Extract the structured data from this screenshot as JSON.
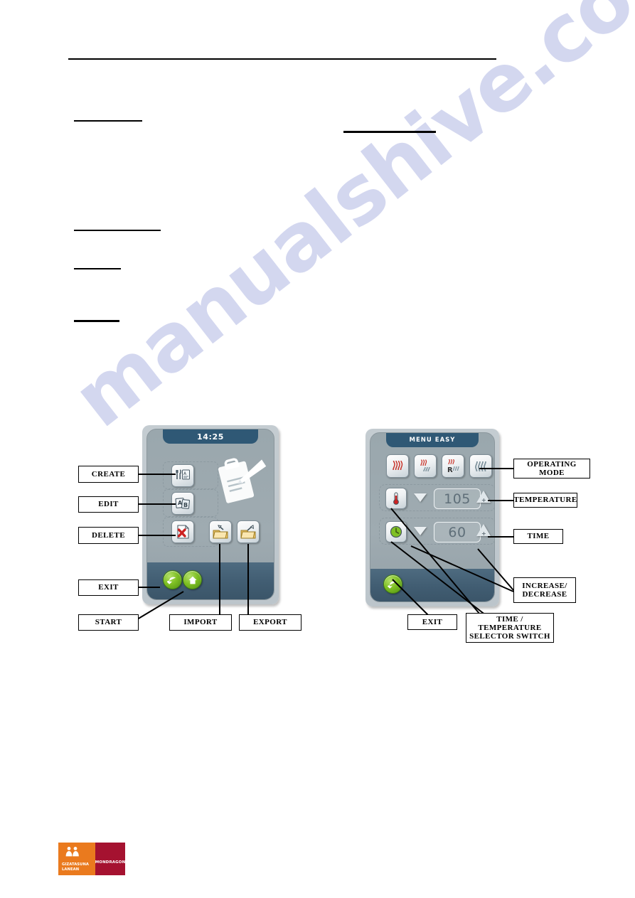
{
  "document": {
    "watermark": "manualshive.com"
  },
  "left_device": {
    "title": "14:25",
    "buttons": {
      "create": "create-recipe-icon",
      "edit": "edit-recipe-icon",
      "delete": "delete-recipe-icon",
      "import": "import-folder-icon",
      "export": "export-folder-icon",
      "back": "back-arrow-icon",
      "home": "home-icon"
    },
    "artwork": "clipboard-pencil-illustration"
  },
  "right_device": {
    "title": "MENU EASY",
    "modes": [
      "convection-heat-icon",
      "heat-steam-icon",
      "regeneration-icon",
      "steam-icon"
    ],
    "temperature": {
      "icon": "thermometer-icon",
      "value": "105",
      "decrease": "decrease-triangle",
      "increase": "increase-triangle"
    },
    "time": {
      "icon": "clock-icon",
      "value": "60",
      "decrease": "decrease-triangle",
      "increase": "increase-triangle"
    },
    "back": "back-arrow-icon"
  },
  "callouts": {
    "create": "CREATE",
    "edit": "EDIT",
    "delete": "DELETE",
    "exit_left": "EXIT",
    "start": "START",
    "import": "IMPORT",
    "export": "EXPORT",
    "operating_mode": "OPERATING MODE",
    "temperature": "TEMPERATURE",
    "time": "TIME",
    "increase_decrease": "INCREASE/\nDECREASE",
    "increase_decrease_l1": "INCREASE/",
    "increase_decrease_l2": "DECREASE",
    "exit_right": "EXIT",
    "selector_l1": "TIME /",
    "selector_l2": "TEMPERATURE",
    "selector_l3": "SELECTOR SWITCH"
  },
  "logo": {
    "line1": "GIZATASUNA",
    "line2": "LANEAN",
    "brand": "MONDRAGON",
    "color_left": "#ea7a1e",
    "color_right": "#a51230"
  }
}
